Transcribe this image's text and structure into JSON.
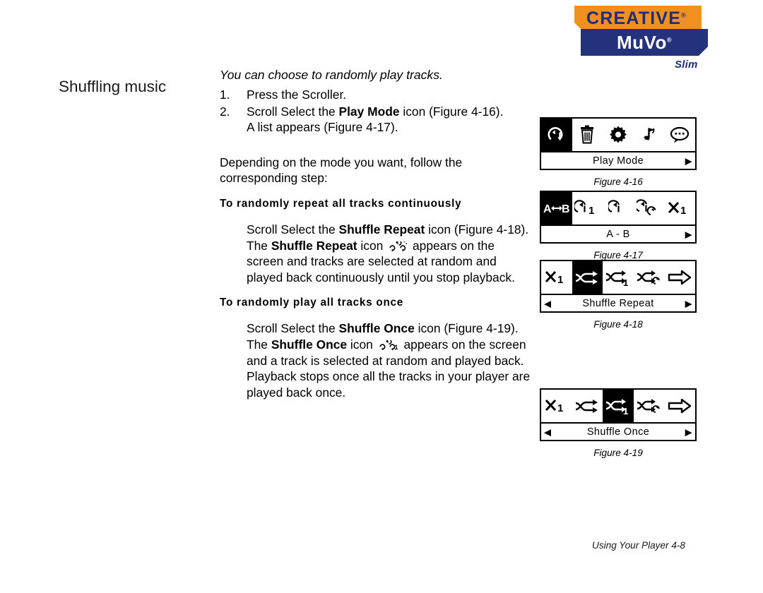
{
  "logo": {
    "brand": "CREATIVE",
    "brand_registered": "®",
    "product": "MuVo",
    "product_registered": "®",
    "variant": "Slim",
    "colors": {
      "orange": "#f0901e",
      "blue": "#24317c",
      "brand_text_blue": "#1b2f7a"
    }
  },
  "section": {
    "heading": "Shuffling music"
  },
  "body": {
    "lead": "You can choose to randomly play tracks.",
    "steps": [
      {
        "num": "1.",
        "text": "Press the Scroller."
      },
      {
        "num": "2.",
        "text_before": "Scroll Select the ",
        "bold": "Play Mode",
        "text_after": " icon (Figure 4-16).",
        "sub_line": "A list appears (Figure 4-17)."
      }
    ],
    "depending_para": "Depending on the mode you want, follow the corresponding step:",
    "section_repeat": {
      "heading": "To randomly repeat all tracks continuously",
      "line1_before": "Scroll Select the ",
      "line1_bold": "Shuffle Repeat",
      "line1_after": " icon (Figure 4-18).",
      "line2_before": "The ",
      "line2_bold": "Shuffle Repeat",
      "line2_mid": " icon ",
      "line2_icon": "shuffle-repeat-inline-icon",
      "line2_after": " appears on the screen and tracks are selected at random and played back continuously until you stop playback."
    },
    "section_once": {
      "heading": "To randomly play all tracks once",
      "line1_before": "Scroll Select the ",
      "line1_bold": "Shuffle Once",
      "line1_after": " icon (Figure 4-19).",
      "line2_before": "The ",
      "line2_bold": "Shuffle Once",
      "line2_mid": " icon ",
      "line2_icon": "shuffle-once-inline-icon",
      "line2_after": " appears on the screen and a track is selected at random and played back. Playback stops once all the tracks in your player are played back once."
    }
  },
  "figures": [
    {
      "id": "figure-4-16",
      "caption": "Figure 4-16",
      "label": "Play Mode",
      "arrow_left": false,
      "arrow_right": true,
      "arrow_left_glyph": "◀",
      "arrow_right_glyph": "▶",
      "selected_index": 0,
      "icons": [
        "play-mode-loop-icon",
        "trash-can-icon",
        "gear-icon",
        "music-note-flag-icon",
        "speech-bubble-icon"
      ]
    },
    {
      "id": "figure-4-17",
      "caption": "Figure 4-17",
      "label": "A - B",
      "arrow_left": false,
      "arrow_right": true,
      "arrow_left_glyph": "◀",
      "arrow_right_glyph": "▶",
      "selected_index": 0,
      "icons": [
        "a-b-repeat-icon",
        "repeat-one-icon",
        "repeat-icon",
        "repeat-all-icon",
        "shuffle-one-icon"
      ]
    },
    {
      "id": "figure-4-18",
      "caption": "Figure 4-18",
      "label": "Shuffle Repeat",
      "arrow_left": true,
      "arrow_right": true,
      "arrow_left_glyph": "◀",
      "arrow_right_glyph": "▶",
      "selected_index": 1,
      "icons": [
        "shuffle-one-icon",
        "shuffle-repeat-icon",
        "shuffle-once-icon",
        "shuffle-all-icon",
        "right-arrow-icon"
      ]
    },
    {
      "id": "figure-4-19",
      "caption": "Figure 4-19",
      "label": "Shuffle Once",
      "arrow_left": true,
      "arrow_right": true,
      "arrow_left_glyph": "◀",
      "arrow_right_glyph": "▶",
      "selected_index": 2,
      "icons": [
        "shuffle-one-icon",
        "shuffle-repeat-icon",
        "shuffle-once-icon",
        "shuffle-all-icon",
        "right-arrow-icon"
      ]
    }
  ],
  "footer": {
    "text": "Using Your Player 4-8"
  }
}
